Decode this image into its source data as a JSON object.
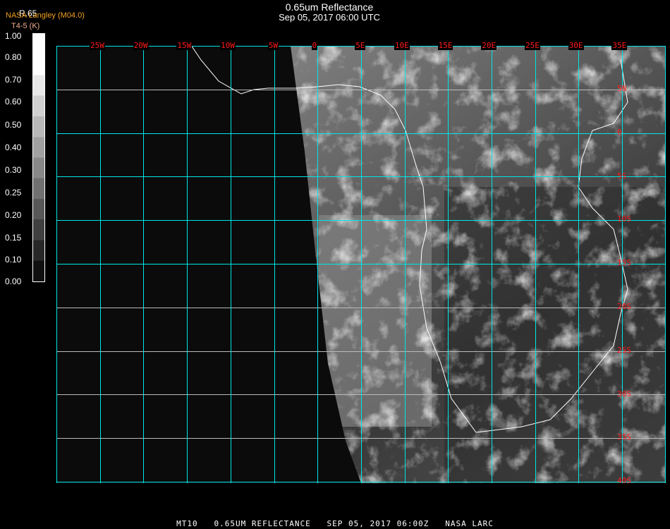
{
  "header": {
    "title": "0.65um Reflectance",
    "subtitle": "Sep 05, 2017 06:00 UTC"
  },
  "legend": {
    "source": "NASA Langley (M04.0)",
    "band": "R.65",
    "alt_band": "T4-5 (K)",
    "ticks": [
      "1.00",
      "0.80",
      "0.70",
      "0.60",
      "0.50",
      "0.40",
      "0.30",
      "0.25",
      "0.20",
      "0.15",
      "0.10",
      "0.00"
    ]
  },
  "map": {
    "lon_labels": [
      "25W",
      "20W",
      "15W",
      "10W",
      "5W",
      "0",
      "5E",
      "10E",
      "15E",
      "20E",
      "25E",
      "30E",
      "35E"
    ],
    "lat_labels": [
      "5N",
      "0",
      "5S",
      "10S",
      "15S",
      "20S",
      "25S",
      "30S",
      "35S",
      "40S"
    ],
    "grid_color": "#00e5e5",
    "label_color": "#ff1a1a",
    "coast_color": "#ffffff"
  },
  "footer": "MT10   0.65UM REFLECTANCE   SEP 05, 2017 06:00Z   NASA LARC"
}
